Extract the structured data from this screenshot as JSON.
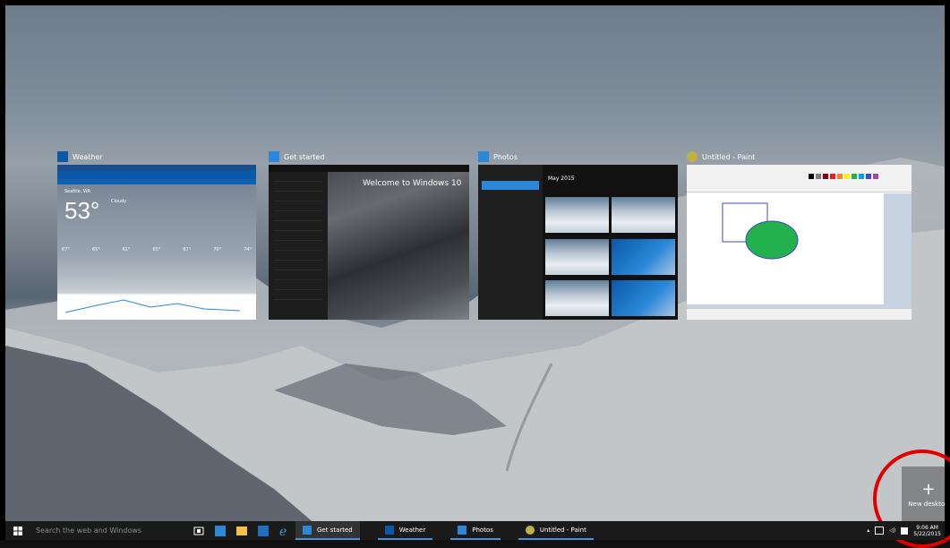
{
  "windows": [
    {
      "title": "Weather",
      "icon": "weather-icon",
      "color": "#0b58a8"
    },
    {
      "title": "Get started",
      "icon": "get-started-icon",
      "color": "#2b88d8"
    },
    {
      "title": "Photos",
      "icon": "photos-icon",
      "color": "#2b88d8"
    },
    {
      "title": "Untitled - Paint",
      "icon": "paint-icon",
      "color": "#3d8a3d"
    }
  ],
  "weather_preview": {
    "city": "Seattle, WA",
    "temp": "53°",
    "condition": "Cloudy",
    "forecast": [
      "67°",
      "65°",
      "61°",
      "65°",
      "67°",
      "70°",
      "74°"
    ]
  },
  "get_started_preview": {
    "welcome": "Welcome to Windows 10"
  },
  "photos_preview": {
    "month": "May 2015"
  },
  "new_desktop": {
    "label": "New desktop",
    "plus": "+"
  },
  "taskbar": {
    "search_placeholder": "Search the web and Windows",
    "apps": [
      {
        "label": "Get started"
      },
      {
        "label": "Weather"
      },
      {
        "label": "Photos"
      },
      {
        "label": "Untitled - Paint"
      }
    ],
    "clock_time": "9:06 AM",
    "clock_date": "5/22/2015"
  },
  "colors": {
    "taskbar_bg": "#1a1a1a",
    "highlight_ring": "#e00000",
    "accent": "#2b88d8"
  }
}
